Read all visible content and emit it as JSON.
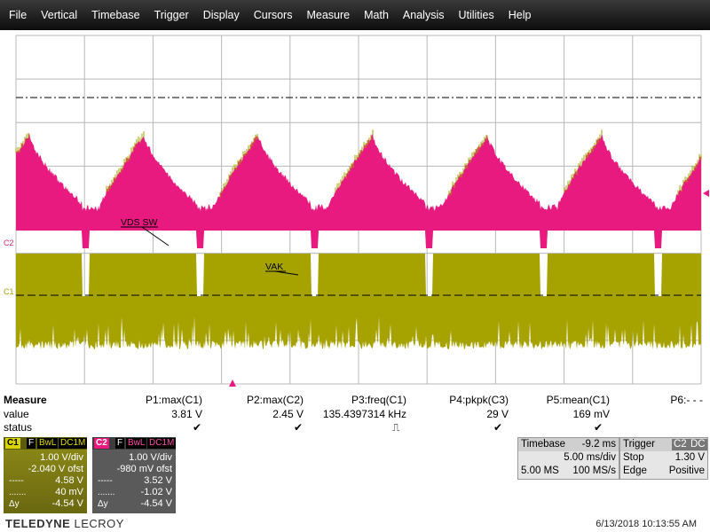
{
  "menu": [
    "File",
    "Vertical",
    "Timebase",
    "Trigger",
    "Display",
    "Cursors",
    "Measure",
    "Math",
    "Analysis",
    "Utilities",
    "Help"
  ],
  "colors": {
    "ch1": "#a6a300",
    "ch2": "#e8197f",
    "grid": "#b0b0b0",
    "menubar": "#1a1a1a"
  },
  "channel_markers": {
    "ch2": "C2",
    "ch1": "C1"
  },
  "annotations": {
    "vds": "VDS SW",
    "vak": "VAK"
  },
  "measure": {
    "header": "Measure",
    "row_value": "value",
    "row_status": "status",
    "params": [
      {
        "name": "P1:max(C1)",
        "value": "3.81 V",
        "status": "✔"
      },
      {
        "name": "P2:max(C2)",
        "value": "2.45 V",
        "status": "✔"
      },
      {
        "name": "P3:freq(C1)",
        "value": "135.4397314 kHz",
        "status": "⎍"
      },
      {
        "name": "P4:pkpk(C3)",
        "value": "29 V",
        "status": "✔"
      },
      {
        "name": "P5:mean(C1)",
        "value": "169 mV",
        "status": "✔"
      },
      {
        "name": "P6:- - -",
        "value": "",
        "status": ""
      }
    ]
  },
  "ch1": {
    "label": "C1",
    "f": "F",
    "bwl": "BwL",
    "coupling": "DC1M",
    "vdiv": "1.00 V/div",
    "offset": "-2.040 V ofst",
    "v1": "4.58 V",
    "v2": "40 mV",
    "dy_label": "Δy",
    "dy": "-4.54 V"
  },
  "ch2": {
    "label": "C2",
    "f": "F",
    "bwl": "BwL",
    "coupling": "DC1M",
    "vdiv": "1.00 V/div",
    "offset": "-980 mV ofst",
    "v1": "3.52 V",
    "v2": "-1.02 V",
    "dy_label": "Δy",
    "dy": "-4.54 V"
  },
  "timebase": {
    "label": "Timebase",
    "delay": "-9.2 ms",
    "tdiv": "5.00 ms/div",
    "samples": "5.00 MS",
    "rate": "100 MS/s"
  },
  "trigger": {
    "label": "Trigger",
    "channel": "C2",
    "coupling": "DC",
    "mode": "Stop",
    "level": "1.30 V",
    "type": "Edge",
    "slope": "Positive"
  },
  "brand": {
    "part1": "TELEDYNE",
    "part2": "LECROY"
  },
  "timestamp": "6/13/2018 10:13:55 AM"
}
